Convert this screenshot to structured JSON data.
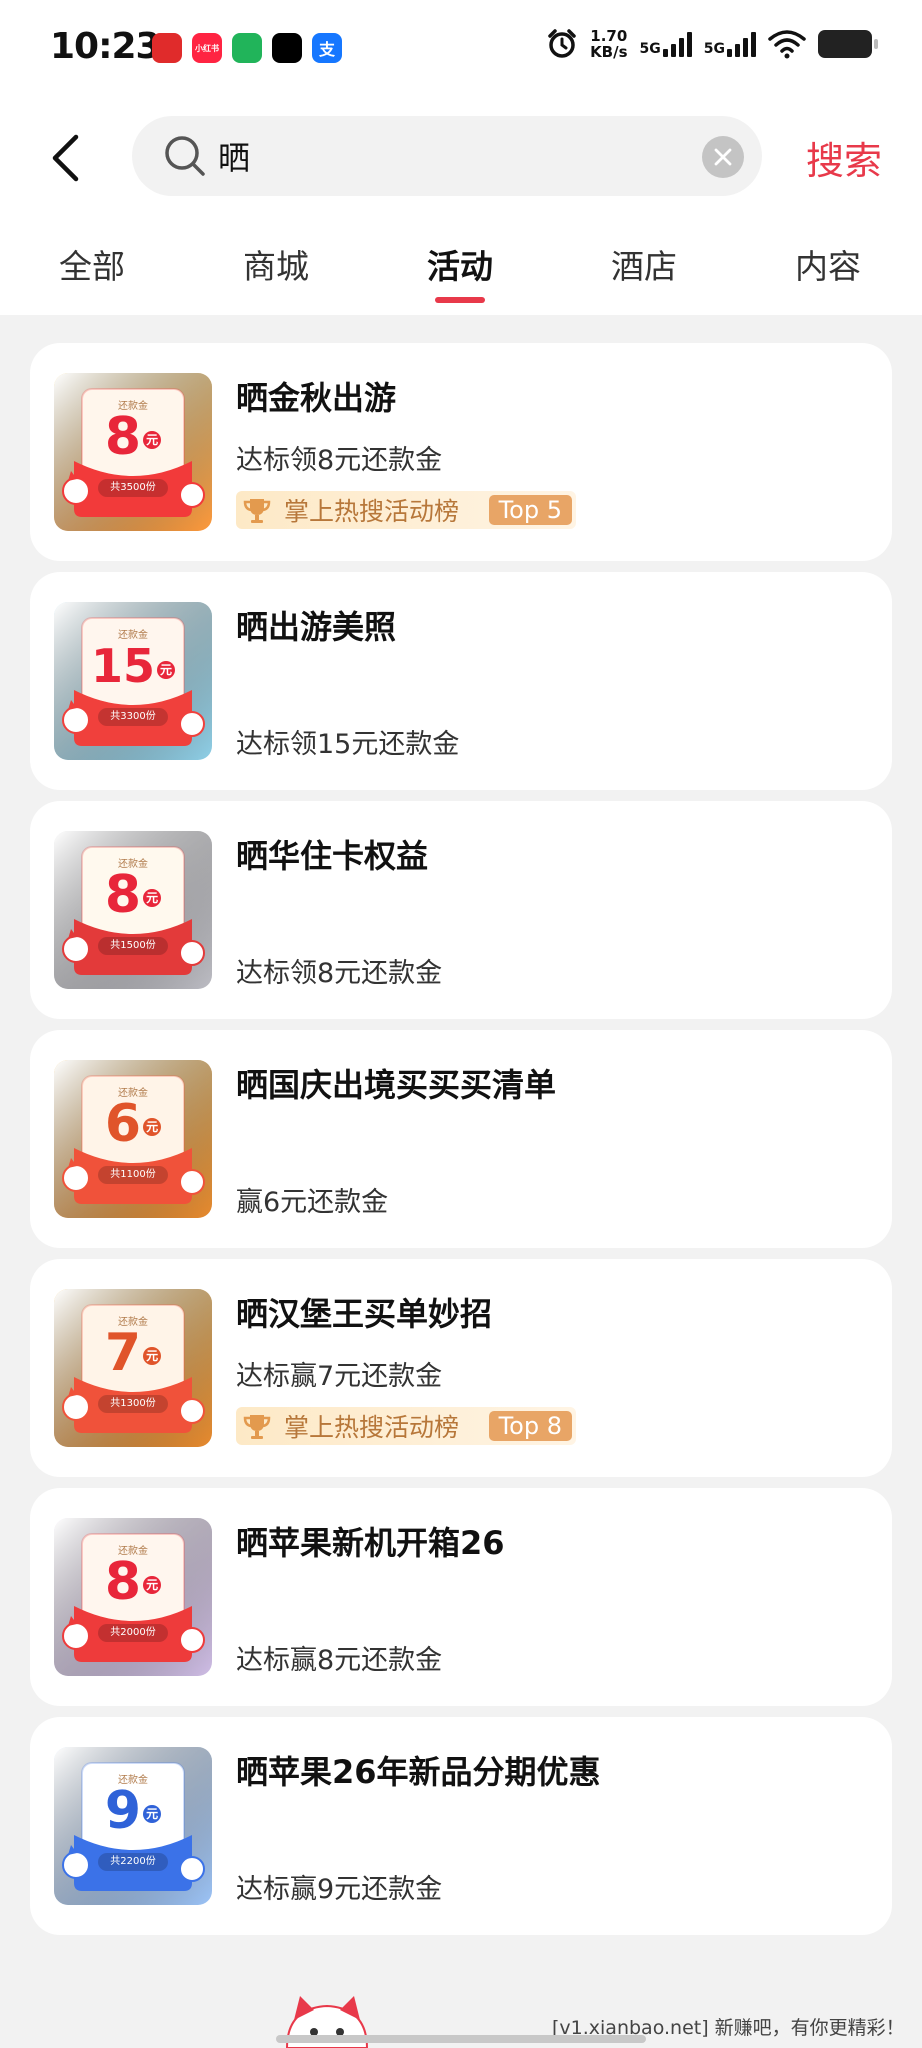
{
  "status_bar": {
    "time": "10:23",
    "apps": [
      {
        "name": "huawei-app-icon",
        "label": "",
        "color": "#e02b2b"
      },
      {
        "name": "xiaohongshu-icon",
        "label": "小红书",
        "color": "#ff2442"
      },
      {
        "name": "eye-app-icon",
        "label": "",
        "color": "#21b45a"
      },
      {
        "name": "tiktok-icon",
        "label": "",
        "color": "#000000"
      },
      {
        "name": "alipay-icon",
        "label": "支",
        "color": "#1677ff"
      }
    ],
    "net_speed_value": "1.70",
    "net_speed_unit": "KB/s",
    "signal_1": "5G",
    "signal_2": "5G"
  },
  "header": {
    "search_query": "晒",
    "search_button": "搜索"
  },
  "tabs": [
    {
      "label": "全部",
      "active": false
    },
    {
      "label": "商城",
      "active": false
    },
    {
      "label": "活动",
      "active": true
    },
    {
      "label": "酒店",
      "active": false
    },
    {
      "label": "内容",
      "active": false
    }
  ],
  "colors": {
    "accent": "#e8394a",
    "rank_text": "#b7773a",
    "rank_tag": "#e8a566"
  },
  "items": [
    {
      "title": "晒金秋出游",
      "subtitle": "达标领8元还款金",
      "rank": {
        "label": "掌上热搜活动榜",
        "top": "Top 5"
      },
      "thumb": {
        "header": "还款金",
        "amount": "8",
        "unit": "元",
        "count": "共3500份",
        "theme": "red-orange"
      }
    },
    {
      "title": "晒出游美照",
      "subtitle": "达标领15元还款金",
      "rank": null,
      "thumb": {
        "header": "还款金",
        "amount": "15",
        "unit": "元",
        "count": "共3300份",
        "theme": "cyan"
      }
    },
    {
      "title": "晒华住卡权益",
      "subtitle": "达标领8元还款金",
      "rank": null,
      "thumb": {
        "header": "还款金",
        "amount": "8",
        "unit": "元",
        "count": "共1500份",
        "theme": "gray"
      }
    },
    {
      "title": "晒国庆出境买买买清单",
      "subtitle": "赢6元还款金",
      "rank": null,
      "thumb": {
        "header": "还款金",
        "amount": "6",
        "unit": "元",
        "count": "共1100份",
        "theme": "orange"
      }
    },
    {
      "title": "晒汉堡王买单妙招",
      "subtitle": "达标赢7元还款金",
      "rank": {
        "label": "掌上热搜活动榜",
        "top": "Top 8"
      },
      "thumb": {
        "header": "还款金",
        "amount": "7",
        "unit": "元",
        "count": "共1300份",
        "theme": "orange"
      }
    },
    {
      "title": "晒苹果新机开箱26",
      "subtitle": "达标赢8元还款金",
      "rank": null,
      "thumb": {
        "header": "还款金",
        "amount": "8",
        "unit": "元",
        "count": "共2000份",
        "theme": "lavender"
      }
    },
    {
      "title": "晒苹果26年新品分期优惠",
      "subtitle": "达标赢9元还款金",
      "rank": null,
      "thumb": {
        "header": "还款金",
        "amount": "9",
        "unit": "元",
        "count": "共2200份",
        "theme": "blue"
      }
    }
  ],
  "watermark": "[v1.xianbao.net] 新赚吧，有你更精彩！"
}
